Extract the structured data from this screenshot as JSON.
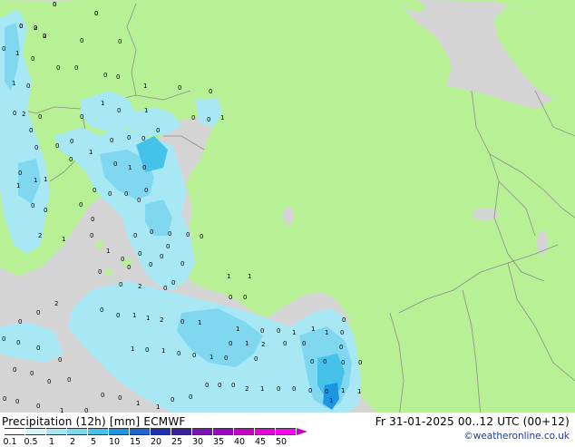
{
  "header": {
    "title": "Precipitation (12h) [mm] ECMWF",
    "valid": "Fr 31-01-2025 00..12 UTC (00+12)",
    "credit": "©weatheronline.co.uk"
  },
  "legend": {
    "items": [
      {
        "label": "0.1",
        "color": "#ffffff"
      },
      {
        "label": "0.5",
        "color": "#d6f5fa"
      },
      {
        "label": "1",
        "color": "#a8e8f5"
      },
      {
        "label": "2",
        "color": "#7fd8f0"
      },
      {
        "label": "5",
        "color": "#45c2ea"
      },
      {
        "label": "10",
        "color": "#1c96e0"
      },
      {
        "label": "15",
        "color": "#1e64d2"
      },
      {
        "label": "20",
        "color": "#2032b4"
      },
      {
        "label": "25",
        "color": "#3c1ea0"
      },
      {
        "label": "30",
        "color": "#7814b4"
      },
      {
        "label": "35",
        "color": "#a000c8"
      },
      {
        "label": "40",
        "color": "#c800c8"
      },
      {
        "label": "45",
        "color": "#e600dc"
      },
      {
        "label": "50",
        "color": "#ff00f0"
      }
    ]
  },
  "map_labels": [
    "0",
    "0",
    "0",
    "0",
    "0",
    "0",
    "1",
    "0",
    "0",
    "0",
    "0",
    "0",
    "0",
    "0",
    "1",
    "0",
    "1",
    "0",
    "0",
    "1",
    "0",
    "0",
    "2",
    "0",
    "1",
    "0",
    "0",
    "0",
    "1",
    "0",
    "0",
    "0",
    "0",
    "0",
    "0",
    "0",
    "0",
    "1",
    "0",
    "0",
    "1",
    "0",
    "0",
    "1",
    "1",
    "0",
    "0",
    "0",
    "0",
    "0",
    "0",
    "0",
    "0",
    "0",
    "1",
    "2",
    "1",
    "0",
    "0",
    "0",
    "0",
    "0",
    "0",
    "0",
    "0",
    "0",
    "1",
    "0",
    "0",
    "0",
    "0",
    "0",
    "0",
    "2",
    "0",
    "0",
    "0",
    "0",
    "0",
    "0",
    "1",
    "1",
    "2",
    "0",
    "1",
    "1",
    "0",
    "0",
    "1",
    "1",
    "1",
    "0",
    "0",
    "1",
    "2",
    "1",
    "0",
    "1",
    "0",
    "0",
    "1",
    "0",
    "0",
    "0",
    "0",
    "0",
    "0",
    "0",
    "0",
    "0",
    "0",
    "0",
    "0",
    "0",
    "2",
    "1",
    "0",
    "0",
    "0",
    "0",
    "1",
    "1",
    "1",
    "1",
    "1",
    "0",
    "0",
    "0",
    "0",
    "0",
    "1",
    "0",
    "0",
    "0",
    "0",
    "0",
    "0",
    "0",
    "0",
    "0",
    "0",
    "0",
    "0",
    "0",
    "2",
    "1",
    "1",
    "0",
    "0",
    "0",
    "2",
    "2"
  ],
  "colors": {
    "sea": "#d4d4d4",
    "land": "#b8f096",
    "border": "#8c8c8c",
    "precip_light": "#a8e8f5",
    "precip_medium": "#7fd8f0",
    "precip_strong": "#45c2ea",
    "precip_heavy": "#1c96e0"
  }
}
